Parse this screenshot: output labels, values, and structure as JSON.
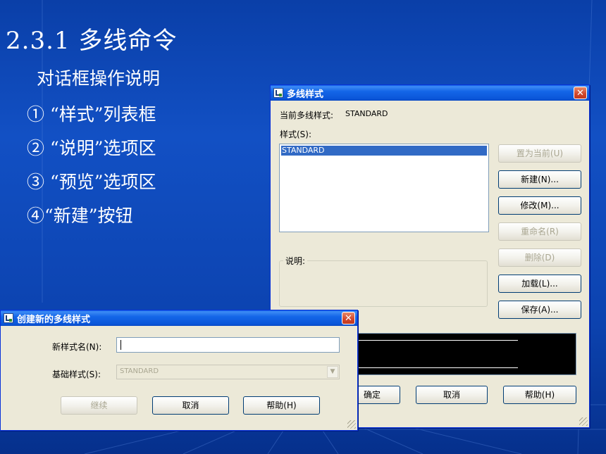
{
  "slide": {
    "title": "2.3.1 多线命令",
    "subtitle": "对话框操作说明",
    "bullets": [
      "① “样式”列表框",
      "② “说明”选项区",
      "③ “预览”选项区",
      "④“新建”按钮"
    ]
  },
  "mlstyle_dialog": {
    "title": "多线样式",
    "current_label": "当前多线样式:",
    "current_value": "STANDARD",
    "styles_label": "样式(S):",
    "styles": [
      "STANDARD"
    ],
    "selected_style": "STANDARD",
    "desc_label": "说明:",
    "buttons": {
      "set_current": "置为当前(U)",
      "new": "新建(N)...",
      "modify": "修改(M)...",
      "rename": "重命名(R)",
      "delete": "删除(D)",
      "load": "加载(L)...",
      "save": "保存(A)..."
    },
    "ok": "确定",
    "cancel": "取消",
    "help": "帮助(H)"
  },
  "new_dialog": {
    "title": "创建新的多线样式",
    "name_label": "新样式名(N):",
    "name_value": "",
    "base_label": "基础样式(S):",
    "base_value": "STANDARD",
    "continue": "继续",
    "cancel": "取消",
    "help": "帮助(H)"
  }
}
